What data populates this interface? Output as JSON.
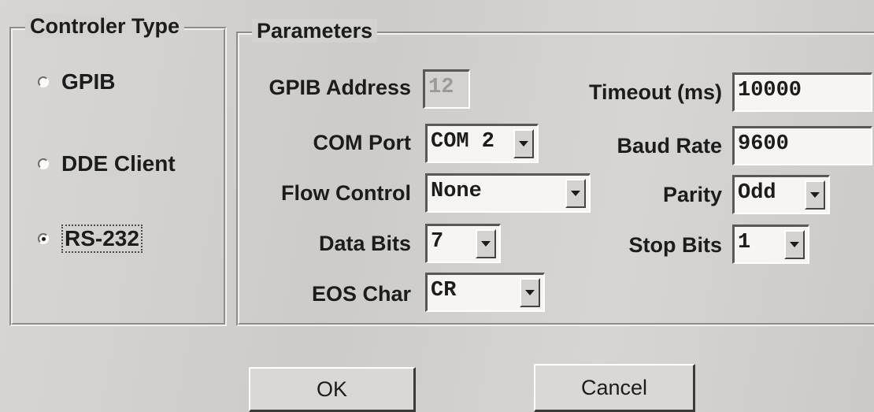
{
  "controller_type": {
    "legend": "Controler Type",
    "options": [
      {
        "label": "GPIB",
        "checked": false
      },
      {
        "label": "DDE Client",
        "checked": false
      },
      {
        "label": "RS-232",
        "checked": true
      }
    ]
  },
  "parameters": {
    "legend": "Parameters",
    "gpib_address": {
      "label": "GPIB Address",
      "value": "12"
    },
    "com_port": {
      "label": "COM Port",
      "value": "COM 2"
    },
    "flow_control": {
      "label": "Flow Control",
      "value": "None"
    },
    "data_bits": {
      "label": "Data Bits",
      "value": "7"
    },
    "eos_char": {
      "label": "EOS Char",
      "value": "CR"
    },
    "timeout": {
      "label": "Timeout (ms)",
      "value": "10000"
    },
    "baud_rate": {
      "label": "Baud Rate",
      "value": "9600"
    },
    "parity": {
      "label": "Parity",
      "value": "Odd"
    },
    "stop_bits": {
      "label": "Stop Bits",
      "value": "1"
    }
  },
  "buttons": {
    "ok": "OK",
    "cancel": "Cancel"
  },
  "icons": {
    "dropdown": "chevron-down-icon",
    "radio": "radio-icon"
  }
}
